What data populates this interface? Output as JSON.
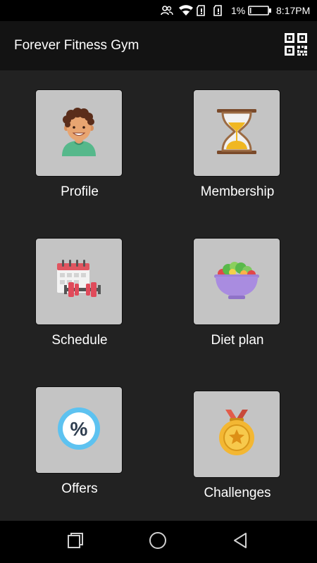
{
  "status_bar": {
    "battery_percent": "1%",
    "time": "8:17PM"
  },
  "app_bar": {
    "title": "Forever Fitness Gym",
    "qr_icon": "qr-code-icon"
  },
  "tiles": [
    {
      "label": "Profile",
      "icon": "profile-avatar-icon"
    },
    {
      "label": "Membership",
      "icon": "hourglass-icon"
    },
    {
      "label": "Schedule",
      "icon": "calendar-dumbbell-icon"
    },
    {
      "label": "Diet plan",
      "icon": "salad-bowl-icon"
    },
    {
      "label": "Offers",
      "icon": "percent-badge-icon"
    },
    {
      "label": "Challenges",
      "icon": "medal-icon"
    }
  ],
  "nav_bar": {
    "icons": [
      "recent-apps-icon",
      "home-icon",
      "back-icon"
    ]
  },
  "colors": {
    "background": "#222222",
    "app_bar": "#131313",
    "tile": "#c4c4c4",
    "text": "#ffffff"
  }
}
